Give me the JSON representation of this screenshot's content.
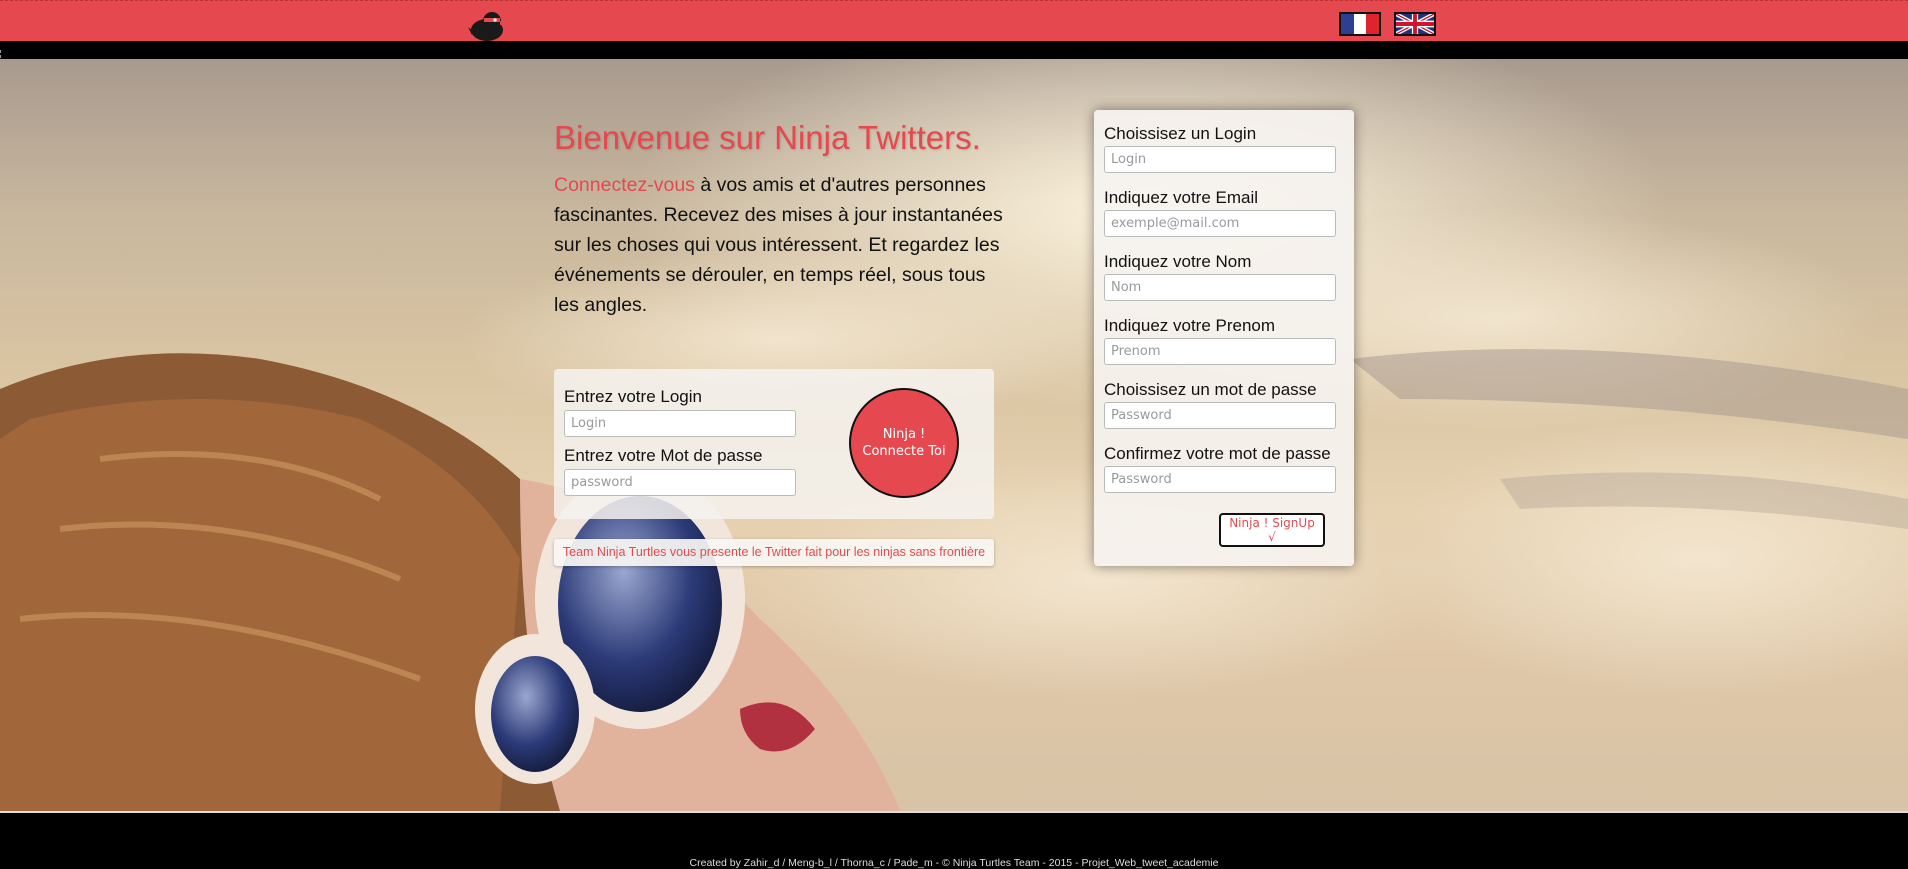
{
  "header": {
    "logo_icon": "ninja-bird-icon",
    "languages": [
      {
        "name": "Français",
        "icon": "france-flag-icon"
      },
      {
        "name": "English",
        "icon": "uk-flag-icon"
      }
    ]
  },
  "main": {
    "title": "Bienvenue sur Ninja Twitters.",
    "intro_highlight": "Connectez-vous",
    "intro_text": " à vos amis et d'autres personnes fascinantes. Recevez des mises à jour instantanées sur les choses qui vous intéressent. Et regardez les événements se dérouler, en temps réel, sous tous les angles.",
    "login_form": {
      "login_label": "Entrez votre Login",
      "login_placeholder": "Login",
      "password_label": "Entrez votre Mot de passe",
      "password_placeholder": "password",
      "submit_line1": "Ninja !",
      "submit_line2": "Connecte Toi"
    },
    "tagline": "Team Ninja Turtles vous presente le Twitter fait pour les ninjas sans frontière"
  },
  "signup_form": {
    "fields": [
      {
        "label": "Choissisez un Login",
        "placeholder": "Login"
      },
      {
        "label": "Indiquez votre Email",
        "placeholder": "exemple@mail.com"
      },
      {
        "label": "Indiquez votre Nom",
        "placeholder": "Nom"
      },
      {
        "label": "Indiquez votre Prenom",
        "placeholder": "Prenom"
      },
      {
        "label": "Choissisez un mot de passe",
        "placeholder": "Password"
      },
      {
        "label": "Confirmez votre mot de passe",
        "placeholder": "Password"
      }
    ],
    "submit_label": "Ninja ! SignUp √"
  },
  "footer": {
    "credits": "Created by Zahir_d / Meng-b_l / Thorna_c / Pade_m - © Ninja Turtles Team - 2015 - Projet_Web_tweet_academie"
  },
  "colors": {
    "accent": "#e5494f",
    "header_bg": "#e5494f",
    "footer_bg": "#000000"
  }
}
